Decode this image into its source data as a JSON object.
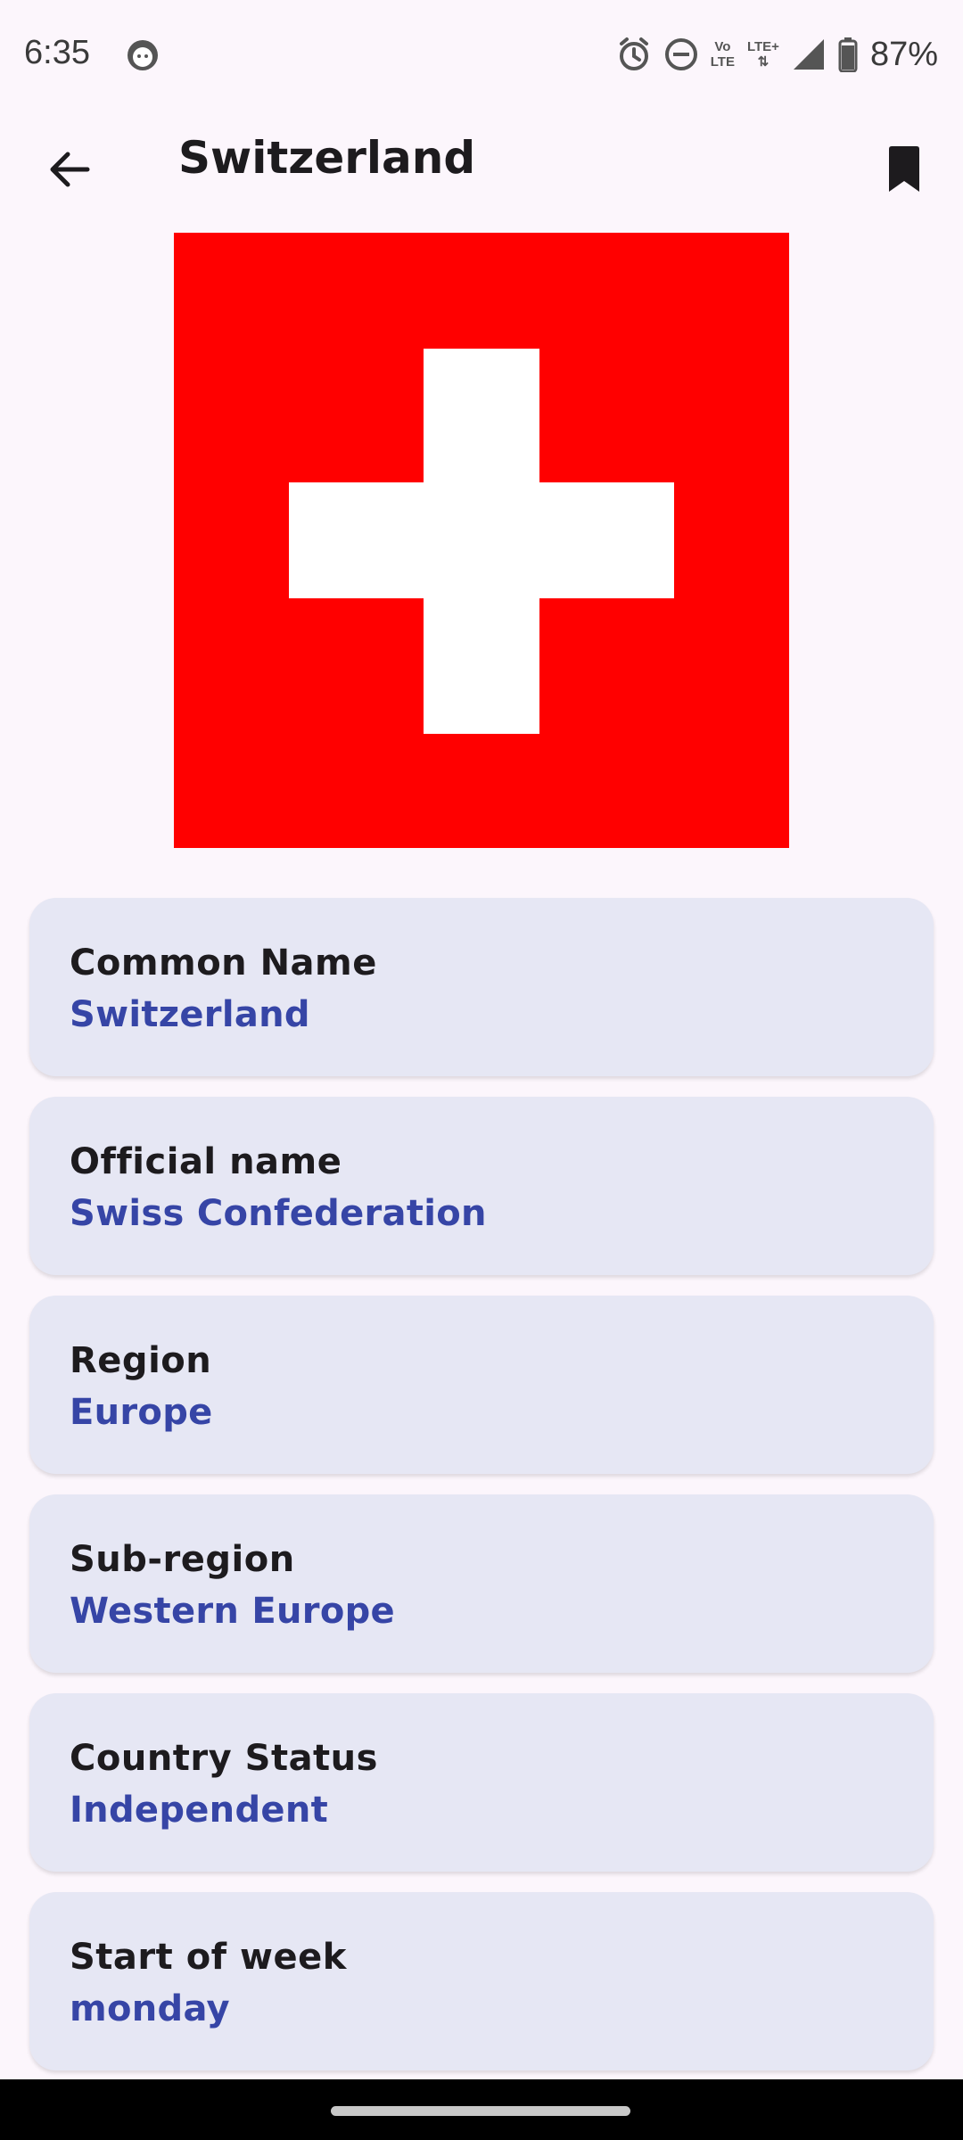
{
  "status_bar": {
    "time": "6:35",
    "battery_text": "87%",
    "network_label_top": "LTE+",
    "volte_label_top": "Vo",
    "volte_label_bottom": "LTE"
  },
  "app_bar": {
    "title": "Switzerland"
  },
  "flag": {
    "country": "Switzerland",
    "colors": {
      "background": "#ff0000",
      "cross": "#ffffff"
    }
  },
  "details": [
    {
      "label": "Common Name",
      "value": "Switzerland"
    },
    {
      "label": "Official name",
      "value": "Swiss Confederation"
    },
    {
      "label": "Region",
      "value": "Europe"
    },
    {
      "label": "Sub-region",
      "value": "Western Europe"
    },
    {
      "label": "Country Status",
      "value": "Independent"
    },
    {
      "label": "Start of week",
      "value": "monday"
    }
  ],
  "colors": {
    "background": "#fcf6fc",
    "card_background": "#e6e7f4",
    "value_accent": "#3645a6"
  },
  "icons": {
    "back": "arrow-back-icon",
    "bookmark": "bookmark-icon",
    "alarm": "alarm-icon",
    "dnd": "do-not-disturb-icon",
    "signal": "signal-icon",
    "battery": "battery-charging-icon",
    "notification": "app-notification-icon"
  }
}
